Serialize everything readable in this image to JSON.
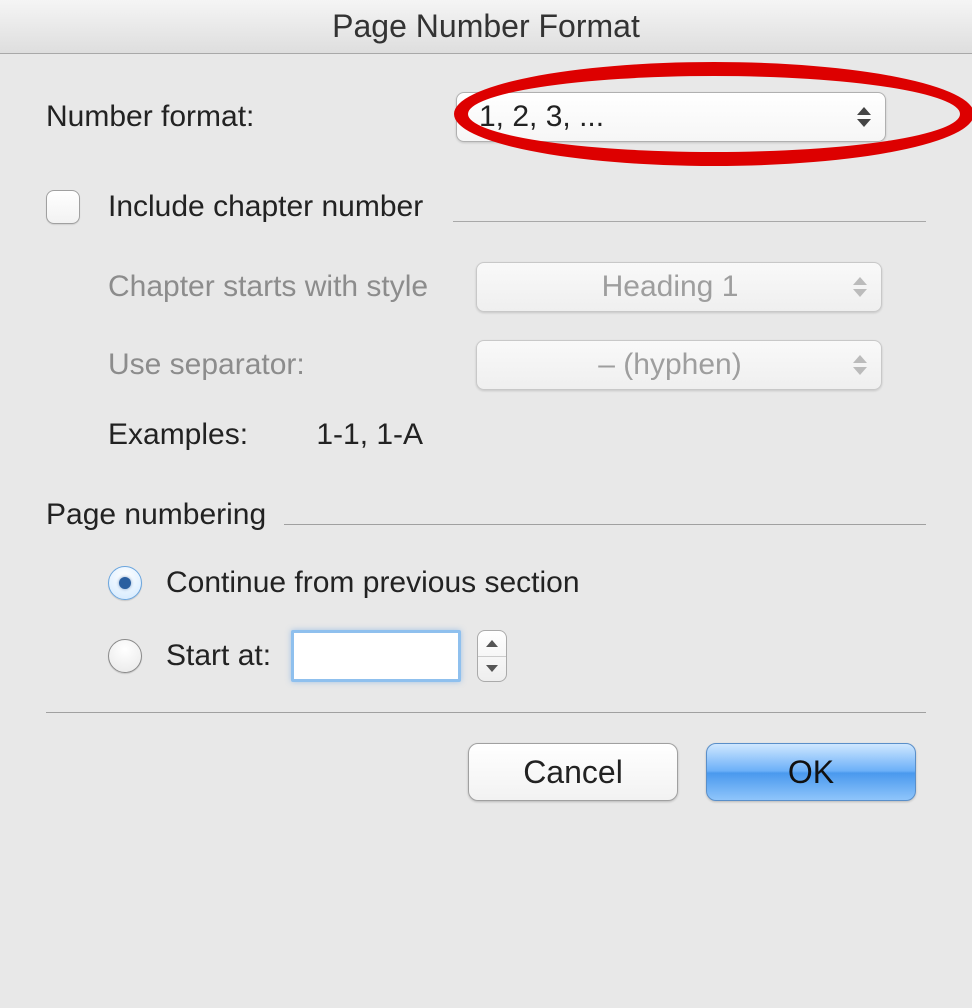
{
  "title": "Page Number Format",
  "numberFormat": {
    "label": "Number format:",
    "value": "1, 2, 3, ..."
  },
  "includeChapter": {
    "label": "Include chapter number",
    "checked": false
  },
  "chapterStarts": {
    "label": "Chapter starts with style",
    "value": "Heading 1"
  },
  "useSeparator": {
    "label": "Use separator:",
    "value": "–   (hyphen)"
  },
  "examples": {
    "label": "Examples:",
    "value": "1-1, 1-A"
  },
  "pageNumbering": {
    "sectionLabel": "Page numbering",
    "continueLabel": "Continue from previous section",
    "startAtLabel": "Start at:",
    "startAtValue": "",
    "selected": "continue"
  },
  "buttons": {
    "cancel": "Cancel",
    "ok": "OK"
  }
}
